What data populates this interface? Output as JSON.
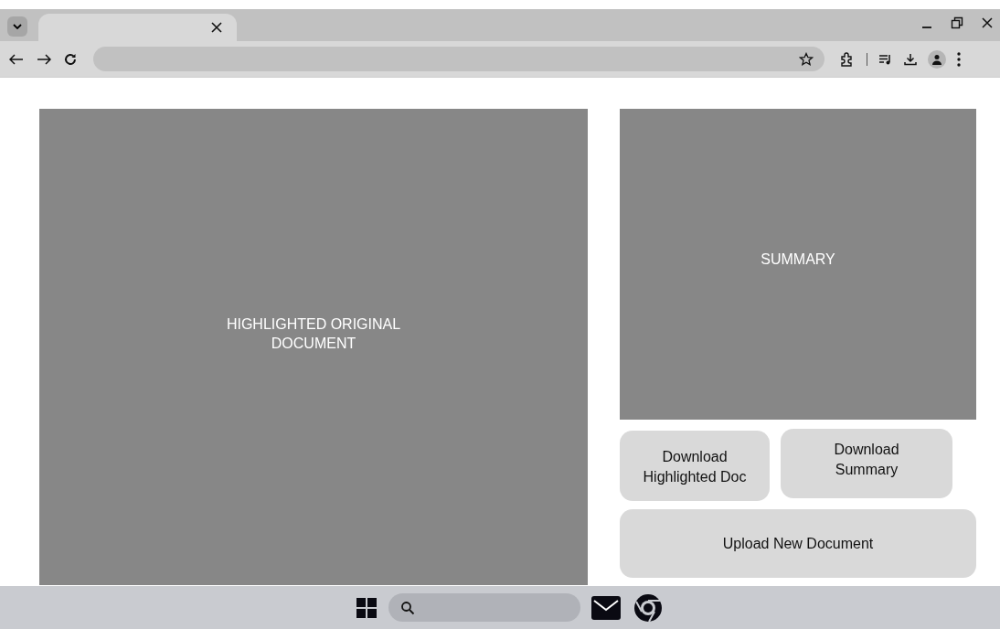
{
  "document_panel": {
    "label": "HIGHLIGHTED ORIGINAL\nDOCUMENT"
  },
  "summary_panel": {
    "label": "SUMMARY"
  },
  "buttons": [
    {
      "label": "Download\nHighlighted Doc"
    },
    {
      "label": "Download\nSummary"
    },
    {
      "label": "Upload New Document"
    }
  ]
}
